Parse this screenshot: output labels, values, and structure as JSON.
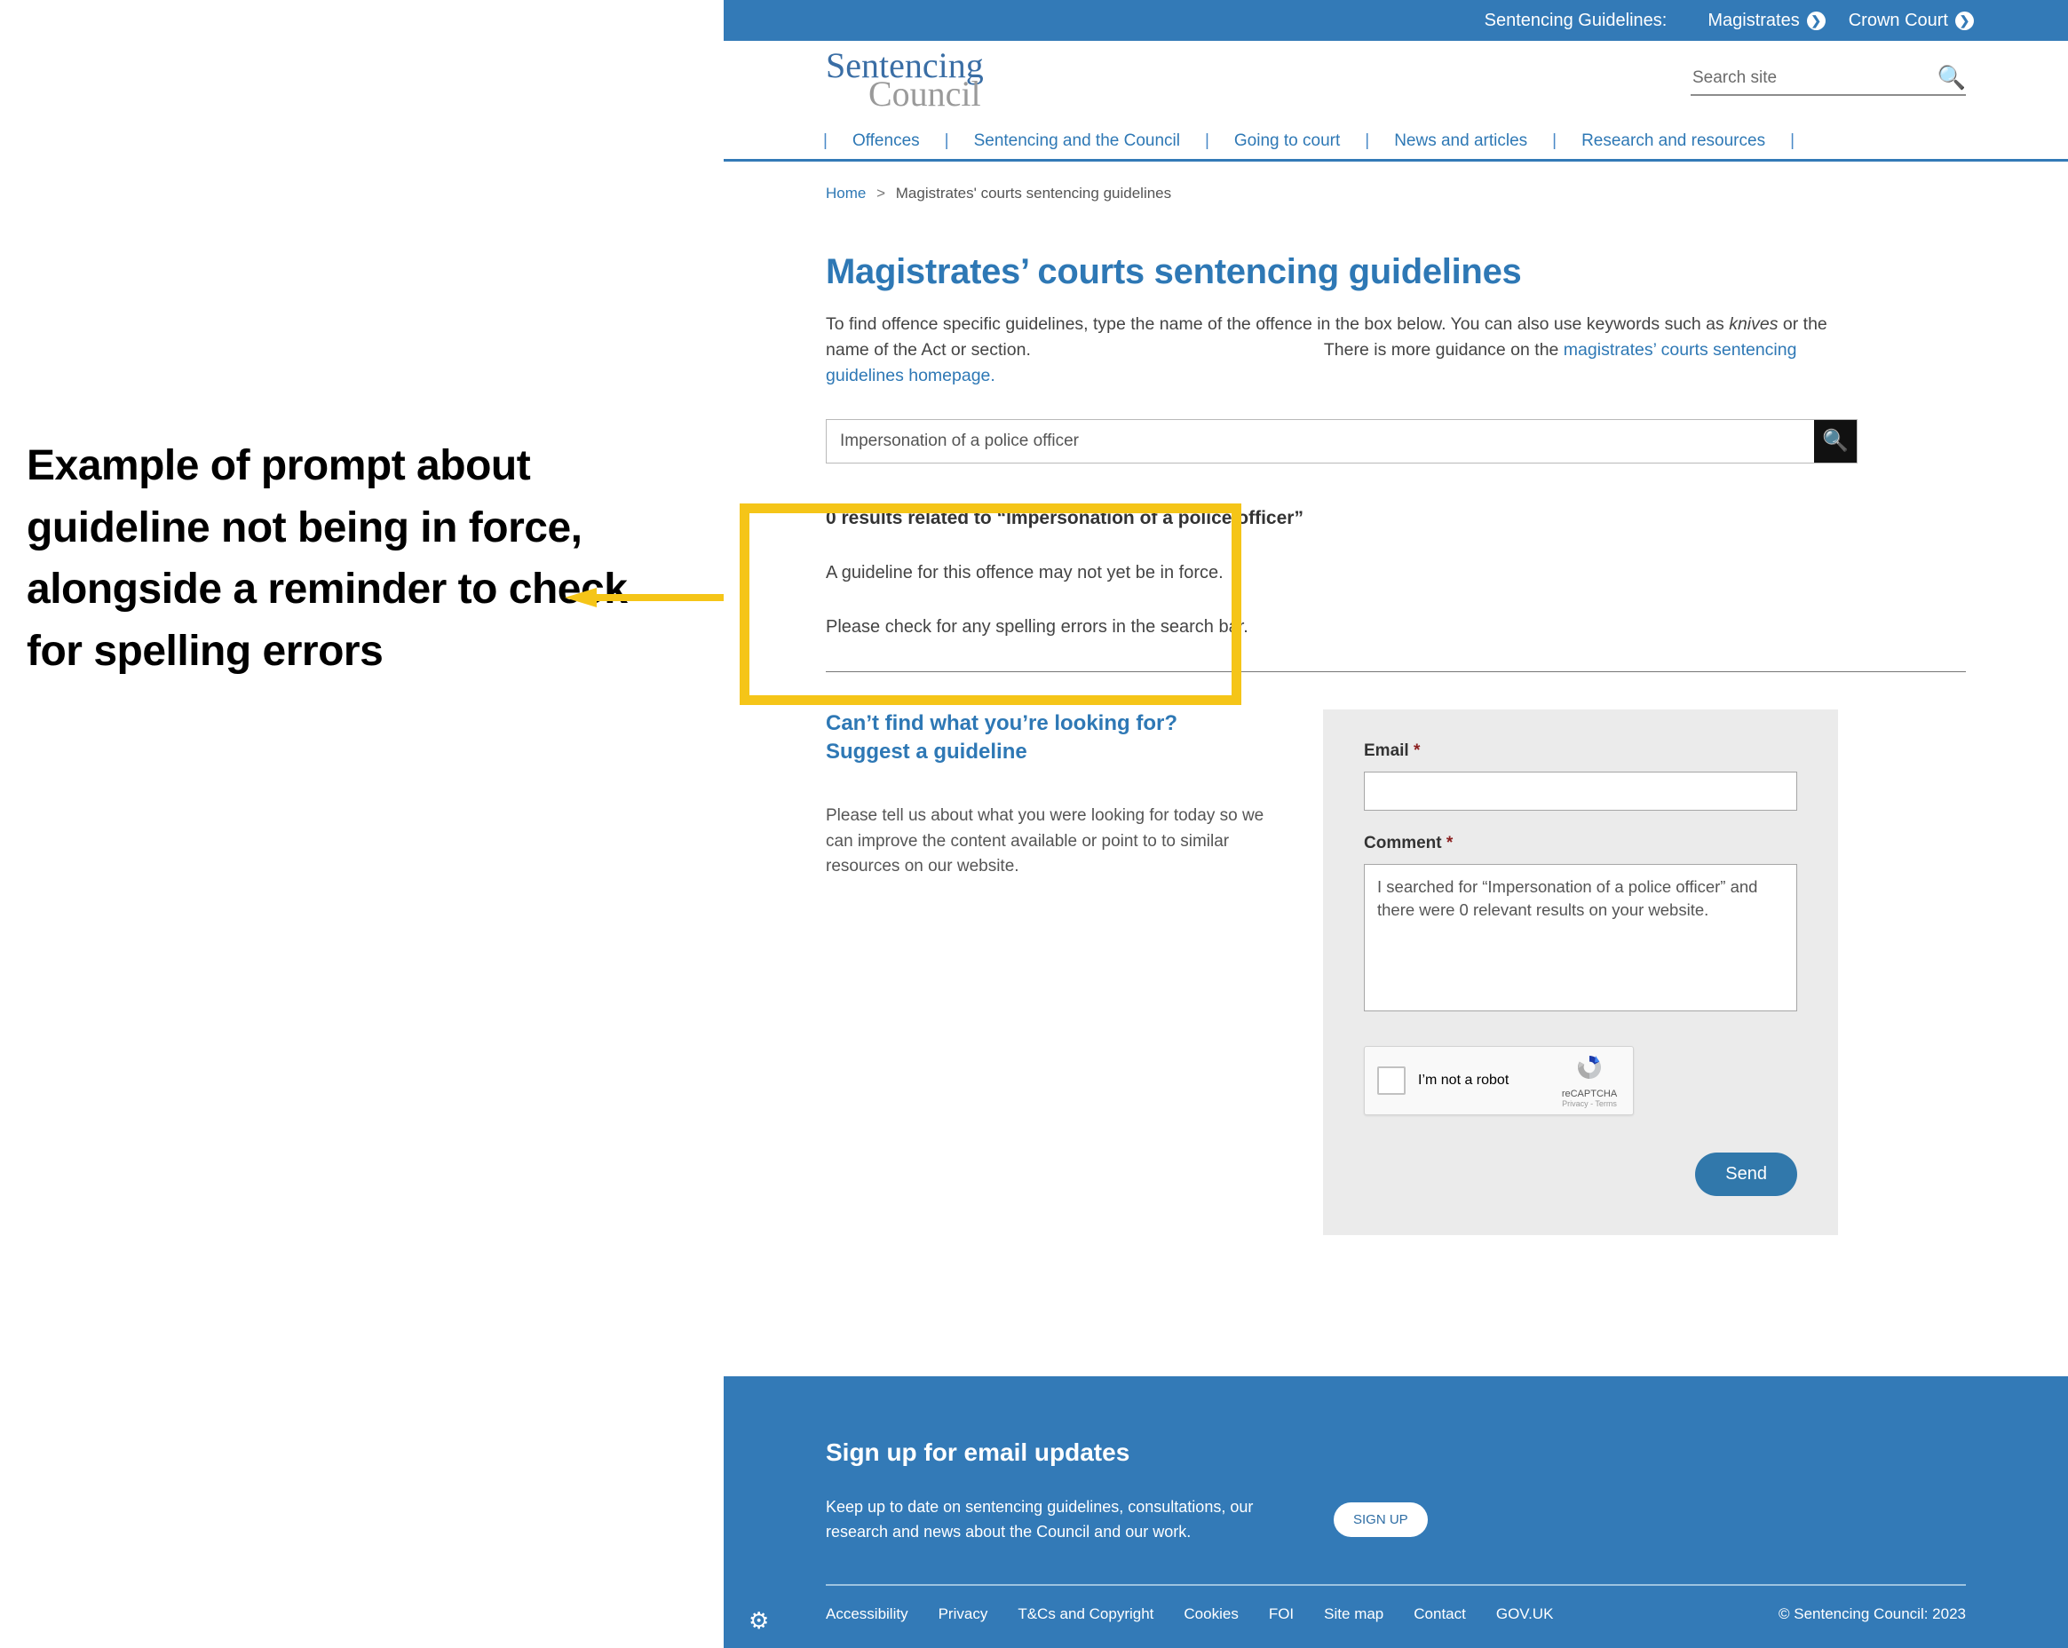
{
  "annotation": {
    "text": "Example of prompt about guideline not being in force, alongside a reminder to check for spelling errors",
    "arrow_color": "#f5c518"
  },
  "highlight": {
    "color": "#f5c518"
  },
  "utility_bar": {
    "label": "Sentencing Guidelines:",
    "links": [
      {
        "label": "Magistrates",
        "icon": "chevron-right-icon"
      },
      {
        "label": "Crown Court",
        "icon": "chevron-right-icon"
      }
    ]
  },
  "brand": {
    "line1": "Sentencing",
    "line2": "Council",
    "line1_color": "#3a6ea5",
    "line2_color": "#9a9a9a"
  },
  "site_search": {
    "value": "",
    "placeholder": "Search site",
    "icon": "search-icon"
  },
  "main_nav": {
    "items": [
      "Offences",
      "Sentencing and the Council",
      "Going to court",
      "News and articles",
      "Research and resources"
    ]
  },
  "breadcrumb": {
    "home": "Home",
    "separator": ">",
    "current": "Magistrates' courts sentencing guidelines"
  },
  "main": {
    "title": "Magistrates’ courts sentencing guidelines",
    "intro_part1": "To find offence specific guidelines, type the name of the offence in the box below. You can also use keywords such as ",
    "intro_keyword": "knives",
    "intro_part2": " or the name of the Act or section.",
    "intro_part3": "There is more guidance on the ",
    "intro_link": "magistrates’ courts sentencing guidelines homepage.",
    "offence_search": {
      "value": "Impersonation of a police officer",
      "placeholder": "",
      "button_icon": "search-icon"
    },
    "results": {
      "count_text": "0 results related to “Impersonation of a police officer”",
      "message_1": "A guideline for this offence may not yet be in force.",
      "message_2": "Please check for any spelling errors in the search bar."
    }
  },
  "suggest": {
    "heading_line1": "Can’t find what you’re looking for?",
    "heading_line2": "Suggest a guideline",
    "body": "Please tell us about what you were looking for today so we can improve the content available or point to to similar resources on our website.",
    "form": {
      "email_label": "Email",
      "email_required": "*",
      "email_value": "",
      "email_placeholder": "",
      "comment_label": "Comment",
      "comment_required": "*",
      "comment_value": "I searched for “Impersonation of a police officer” and there were 0 relevant results on your website.",
      "recaptcha": {
        "checkbox_label": "I’m not a robot",
        "brand": "reCAPTCHA",
        "links": "Privacy - Terms"
      },
      "send_label": "Send"
    }
  },
  "footer": {
    "heading": "Sign up for email updates",
    "body": "Keep up to date on sentencing guidelines, consultations, our research and news about the Council and our work.",
    "signup_label": "SIGN UP",
    "links": [
      "Accessibility",
      "Privacy",
      "T&Cs and Copyright",
      "Cookies",
      "FOI",
      "Site map",
      "Contact",
      "GOV.UK"
    ],
    "copyright": "© Sentencing Council: 2023",
    "cookie_icon": "gear-icon",
    "background": "#337ab7"
  }
}
